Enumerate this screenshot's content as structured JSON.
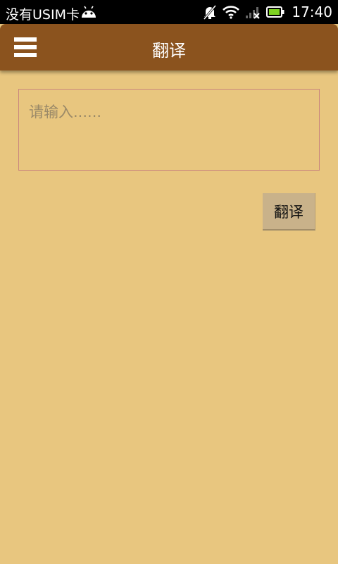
{
  "status_bar": {
    "carrier": "没有USIM卡",
    "time": "17:40",
    "icons": [
      "android-icon",
      "silent-icon",
      "wifi-icon",
      "signal-icon",
      "battery-icon"
    ]
  },
  "app_bar": {
    "title": "翻译",
    "menu_icon": "hamburger-menu-icon",
    "color": "#8b531e"
  },
  "input": {
    "placeholder": "请输入......",
    "value": ""
  },
  "translate_button": {
    "label": "翻译"
  },
  "colors": {
    "background": "#e8c67f",
    "button": "#c9b28a",
    "input_border": "#c9867e"
  }
}
